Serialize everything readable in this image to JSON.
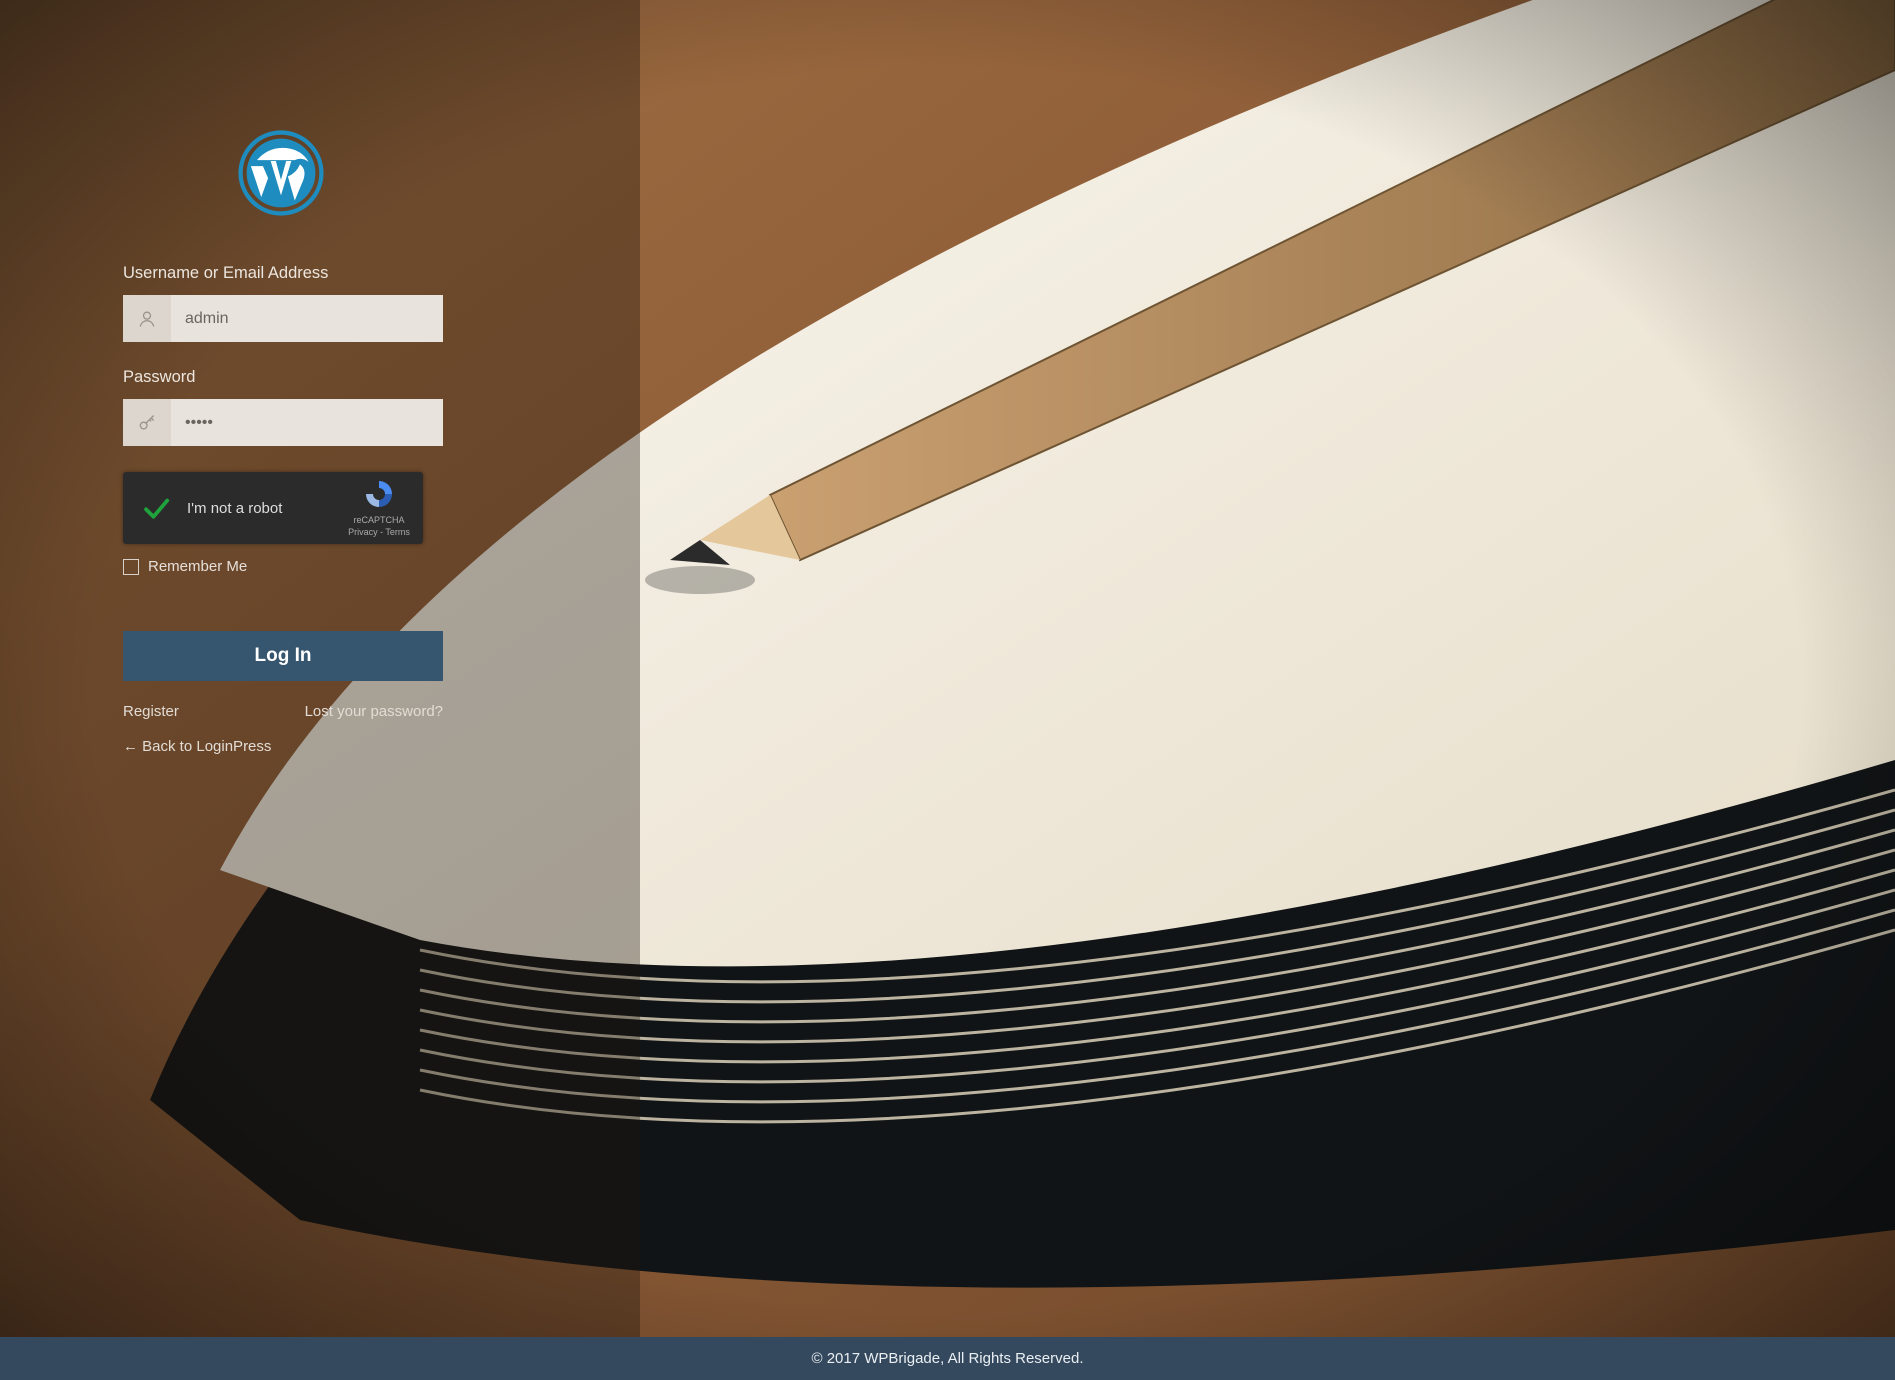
{
  "form": {
    "username_label": "Username or Email Address",
    "username_value": "admin",
    "password_label": "Password",
    "password_value": "•••••",
    "remember_label": "Remember Me",
    "submit_label": "Log In"
  },
  "recaptcha": {
    "label": "I'm not a robot",
    "brand": "reCAPTCHA",
    "legal": "Privacy - Terms",
    "checked": true
  },
  "links": {
    "register": "Register",
    "lost_password": "Lost your password?",
    "back": "← Back to LoginPress"
  },
  "footer": {
    "copyright": "© 2017 WPBrigade, All Rights Reserved."
  },
  "colors": {
    "accent": "#36556e",
    "footer_bg": "#34495e",
    "logo": "#1e8cbe"
  }
}
